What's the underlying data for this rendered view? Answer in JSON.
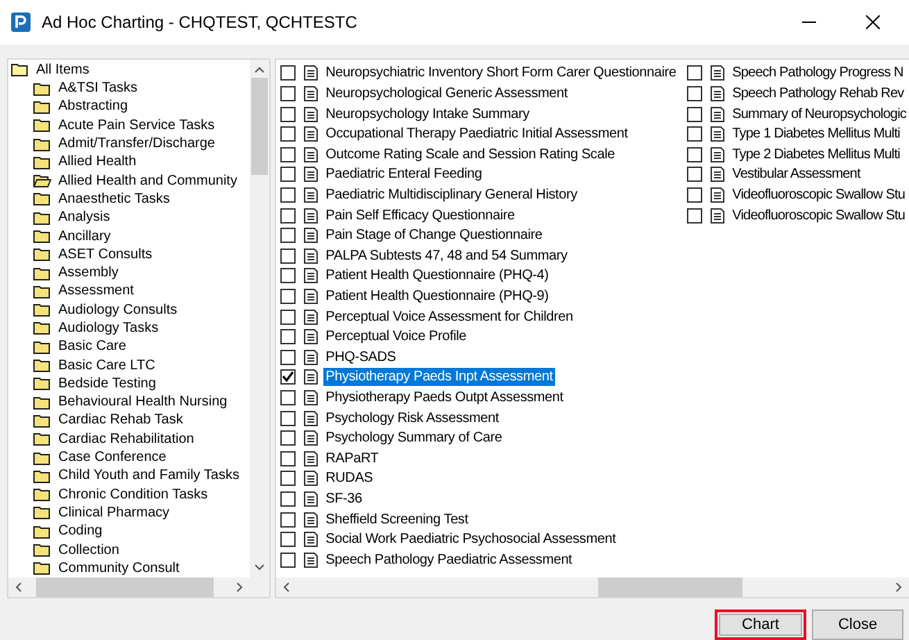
{
  "window": {
    "title": "Ad Hoc Charting - CHQTEST, QCHTESTC"
  },
  "tree": {
    "label": "All Items",
    "expanded": true,
    "children": [
      {
        "label": "A&TSI Tasks",
        "expanded": false
      },
      {
        "label": "Abstracting",
        "expanded": false
      },
      {
        "label": "Acute Pain Service Tasks",
        "expanded": false
      },
      {
        "label": "Admit/Transfer/Discharge",
        "expanded": false
      },
      {
        "label": "Allied Health",
        "expanded": false
      },
      {
        "label": "Allied Health and Community",
        "expanded": true
      },
      {
        "label": "Anaesthetic Tasks",
        "expanded": false
      },
      {
        "label": "Analysis",
        "expanded": false
      },
      {
        "label": "Ancillary",
        "expanded": false
      },
      {
        "label": "ASET Consults",
        "expanded": false
      },
      {
        "label": "Assembly",
        "expanded": false
      },
      {
        "label": "Assessment",
        "expanded": false
      },
      {
        "label": "Audiology Consults",
        "expanded": false
      },
      {
        "label": "Audiology Tasks",
        "expanded": false
      },
      {
        "label": "Basic Care",
        "expanded": false
      },
      {
        "label": "Basic Care LTC",
        "expanded": false
      },
      {
        "label": "Bedside Testing",
        "expanded": false
      },
      {
        "label": "Behavioural Health Nursing",
        "expanded": false
      },
      {
        "label": "Cardiac Rehab Task",
        "expanded": false
      },
      {
        "label": "Cardiac Rehabilitation",
        "expanded": false
      },
      {
        "label": "Case Conference",
        "expanded": false
      },
      {
        "label": "Child Youth and Family Tasks",
        "expanded": false
      },
      {
        "label": "Chronic Condition Tasks",
        "expanded": false
      },
      {
        "label": "Clinical Pharmacy",
        "expanded": false
      },
      {
        "label": "Coding",
        "expanded": false
      },
      {
        "label": "Collection",
        "expanded": false
      },
      {
        "label": "Community Consult",
        "expanded": false
      }
    ]
  },
  "forms": {
    "column_1": [
      {
        "label": "Neuropsychiatric Inventory Short Form Carer Questionnaire",
        "checked": false,
        "selected": false
      },
      {
        "label": "Neuropsychological Generic Assessment",
        "checked": false,
        "selected": false
      },
      {
        "label": "Neuropsychology Intake Summary",
        "checked": false,
        "selected": false
      },
      {
        "label": "Occupational Therapy Paediatric Initial Assessment",
        "checked": false,
        "selected": false
      },
      {
        "label": "Outcome Rating Scale and Session Rating Scale",
        "checked": false,
        "selected": false
      },
      {
        "label": "Paediatric Enteral Feeding",
        "checked": false,
        "selected": false
      },
      {
        "label": "Paediatric Multidisciplinary General History",
        "checked": false,
        "selected": false
      },
      {
        "label": "Pain Self Efficacy Questionnaire",
        "checked": false,
        "selected": false
      },
      {
        "label": "Pain Stage of Change Questionnaire",
        "checked": false,
        "selected": false
      },
      {
        "label": "PALPA Subtests 47, 48 and 54 Summary",
        "checked": false,
        "selected": false
      },
      {
        "label": "Patient Health Questionnaire (PHQ-4)",
        "checked": false,
        "selected": false
      },
      {
        "label": "Patient Health Questionnaire (PHQ-9)",
        "checked": false,
        "selected": false
      },
      {
        "label": "Perceptual Voice Assessment for Children",
        "checked": false,
        "selected": false
      },
      {
        "label": "Perceptual Voice Profile",
        "checked": false,
        "selected": false
      },
      {
        "label": "PHQ-SADS",
        "checked": false,
        "selected": false
      },
      {
        "label": "Physiotherapy Paeds Inpt Assessment",
        "checked": true,
        "selected": true
      },
      {
        "label": "Physiotherapy Paeds Outpt Assessment",
        "checked": false,
        "selected": false
      },
      {
        "label": "Psychology Risk Assessment",
        "checked": false,
        "selected": false
      },
      {
        "label": "Psychology Summary of Care",
        "checked": false,
        "selected": false
      },
      {
        "label": "RAPaRT",
        "checked": false,
        "selected": false
      },
      {
        "label": "RUDAS",
        "checked": false,
        "selected": false
      },
      {
        "label": "SF-36",
        "checked": false,
        "selected": false
      },
      {
        "label": "Sheffield Screening Test",
        "checked": false,
        "selected": false
      },
      {
        "label": "Social Work Paediatric Psychosocial Assessment",
        "checked": false,
        "selected": false
      },
      {
        "label": "Speech Pathology Paediatric Assessment",
        "checked": false,
        "selected": false
      }
    ],
    "column_2": [
      {
        "label": "Speech Pathology Progress N",
        "checked": false,
        "selected": false
      },
      {
        "label": "Speech Pathology Rehab Rev",
        "checked": false,
        "selected": false
      },
      {
        "label": "Summary of Neuropsychologic",
        "checked": false,
        "selected": false
      },
      {
        "label": "Type 1 Diabetes Mellitus Multi",
        "checked": false,
        "selected": false
      },
      {
        "label": "Type 2 Diabetes Mellitus Multi",
        "checked": false,
        "selected": false
      },
      {
        "label": "Vestibular Assessment",
        "checked": false,
        "selected": false
      },
      {
        "label": "Videofluoroscopic Swallow Stu",
        "checked": false,
        "selected": false
      },
      {
        "label": "Videofluoroscopic Swallow Stu",
        "checked": false,
        "selected": false
      }
    ]
  },
  "buttons": [
    {
      "label": "Chart",
      "highlighted": true
    },
    {
      "label": "Close",
      "highlighted": false
    }
  ]
}
